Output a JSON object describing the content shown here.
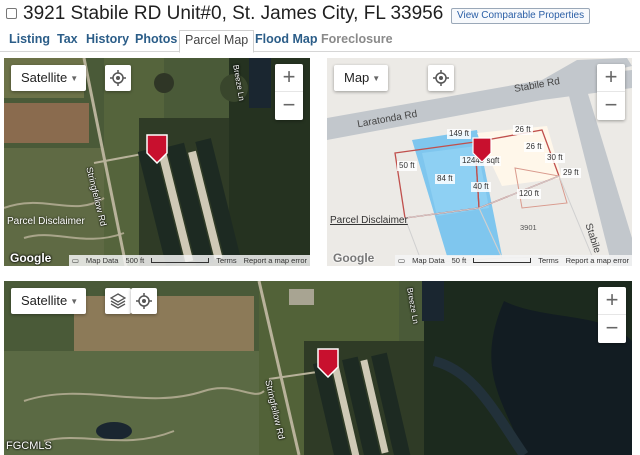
{
  "header": {
    "address": "3921 Stabile RD Unit#0, St. James City, FL 33956",
    "comparable_button": "View Comparable Properties"
  },
  "tabs": [
    {
      "label": "Listing"
    },
    {
      "label": "Tax"
    },
    {
      "label": "History"
    },
    {
      "label": "Photos"
    },
    {
      "label": "Parcel Map"
    },
    {
      "label": "Flood Map"
    },
    {
      "label": "Foreclosure"
    }
  ],
  "active_tab": "Parcel Map",
  "map1": {
    "type_label": "Satellite",
    "disclaimer": "Parcel Disclaimer",
    "road_label_1": "Stringfellow Rd",
    "road_label_2": "Breeze Ln",
    "google": "Google",
    "footer": {
      "map_data": "Map Data",
      "scale": "500 ft",
      "terms": "Terms",
      "report": "Report a map error"
    }
  },
  "map2": {
    "type_label": "Map",
    "disclaimer": "Parcel Disclaimer",
    "google": "Google",
    "streets": [
      "Laratonda Rd",
      "Stabile Rd",
      "Stabile"
    ],
    "dimensions": [
      "149 ft",
      "26 ft",
      "26 ft",
      "30 ft",
      "29 ft",
      "50 ft",
      "12449 sqft",
      "84 ft",
      "40 ft",
      "120 ft"
    ],
    "lot_number": "3901",
    "footer": {
      "map_data": "Map Data",
      "scale": "50 ft",
      "terms": "Terms",
      "report": "Report a map error"
    }
  },
  "map3": {
    "type_label": "Satellite",
    "road_label_1": "Stringfellow Rd",
    "road_label_2": "Breeze Ln",
    "watermark": "FGCMLS"
  },
  "colors": {
    "marker": "#c8102e",
    "parcel_outline": "#c0504d",
    "pool_blue": "#7fc6ee",
    "link_blue": "#2b5d88"
  }
}
